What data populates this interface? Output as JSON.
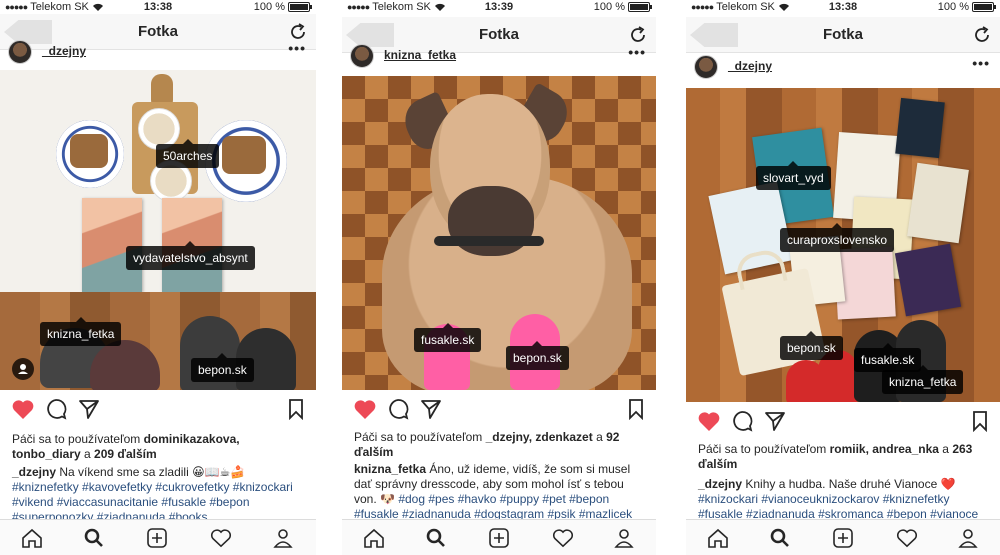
{
  "status": {
    "carrier": "Telekom SK",
    "battery": "100 %"
  },
  "screen_title": "Fotka",
  "colors": {
    "heart": "#ed4956",
    "hashtag": "#2b4f7e",
    "tag_bg": "#000000"
  },
  "icons": [
    "back-arrow",
    "refresh",
    "heart-filled",
    "comment",
    "share",
    "bookmark",
    "home",
    "search",
    "add",
    "activity-heart",
    "profile"
  ],
  "posts": [
    {
      "time": "13:38",
      "username": "_dzejny",
      "more": "•••",
      "tags": [
        "50arches",
        "vydavatelstvo_absynt",
        "knizna_fetka",
        "bepon.sk"
      ],
      "likes_prefix": "Páči sa to používateľom ",
      "likes_users": "dominikazakova, tonbo_diary",
      "likes_and": " a ",
      "likes_count": "209 ďalším",
      "caption_user": "_dzejny",
      "caption_text": " Na víkend sme sa zladili 😀📖☕🍰",
      "caption_tags": "#kniznefetky #kavovefetky #cukrovefetky #knizockari #vikend #viaccasunacitanie #fusakle #bepon #superponozky #ziadnanuda #books"
    },
    {
      "time": "13:39",
      "username": "knizna_fetka",
      "more": "•••",
      "tags": [
        "fusakle.sk",
        "bepon.sk"
      ],
      "likes_prefix": "Páči sa to používateľom ",
      "likes_users": "_dzejny, zdenkazet",
      "likes_and": " a ",
      "likes_count": "92 ďalším",
      "caption_user": "knizna_fetka",
      "caption_text": " Áno, už ideme, vidíš, že som si musel dať správny dresscode, aby som mohol ísť s tebou von. 🐶",
      "caption_tags": "#dog #pes #havko #puppy #pet #bepon #fusakle #ziadnanuda #dogstagram #psik #mazlicek"
    },
    {
      "time": "13:38",
      "username": "_dzejny",
      "more": "•••",
      "tags": [
        "slovart_vyd",
        "curaproxslovensko",
        "bepon.sk",
        "fusakle.sk",
        "knizna_fetka"
      ],
      "likes_prefix": "Páči sa to používateľom ",
      "likes_users": "romiik, andrea_nka",
      "likes_and": " a ",
      "likes_count": "263 ďalším",
      "caption_user": "_dzejny",
      "caption_text": " Knihy a hudba. Naše druhé Vianoce ❤️",
      "caption_tags": "#knizockari #vianoceuknizockarov #kniznefetky #fusakle #ziadnanuda #skromanca #bepon #vianoce"
    }
  ]
}
